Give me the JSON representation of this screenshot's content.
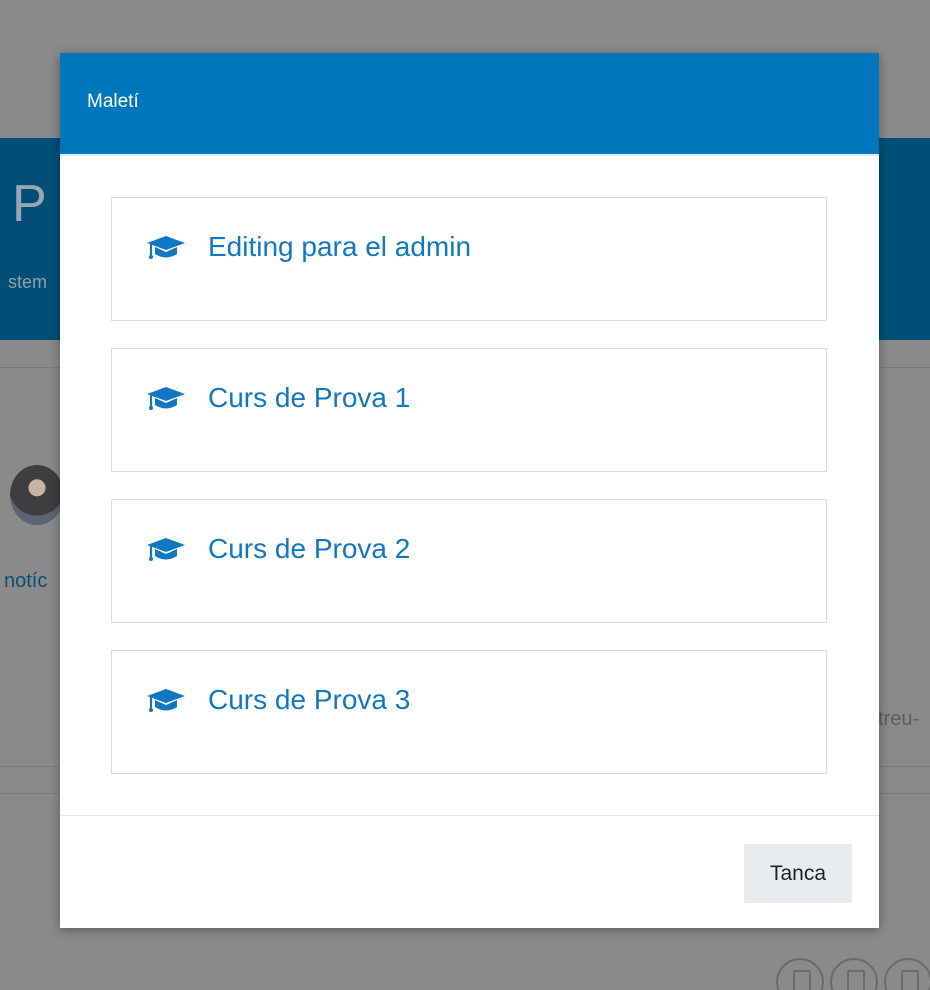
{
  "modal": {
    "title": "Maletí",
    "courses": [
      {
        "name": "Editing para el admin",
        "icon": "graduation-cap-icon"
      },
      {
        "name": "Curs de Prova 1",
        "icon": "graduation-cap-icon"
      },
      {
        "name": "Curs de Prova 2",
        "icon": "graduation-cap-icon"
      },
      {
        "name": "Curs de Prova 3",
        "icon": "graduation-cap-icon"
      }
    ],
    "close_label": "Tanca"
  },
  "background": {
    "title_fragment": "P",
    "subtitle_fragment": "stem",
    "news_fragment": "notíc",
    "right_fragment": "treu-"
  },
  "colors": {
    "accent": "#0076bd",
    "link": "#1177c1",
    "overlay": "#8a8a8a",
    "background_band": "#014f78",
    "close_button_bg": "#e9ecef"
  }
}
